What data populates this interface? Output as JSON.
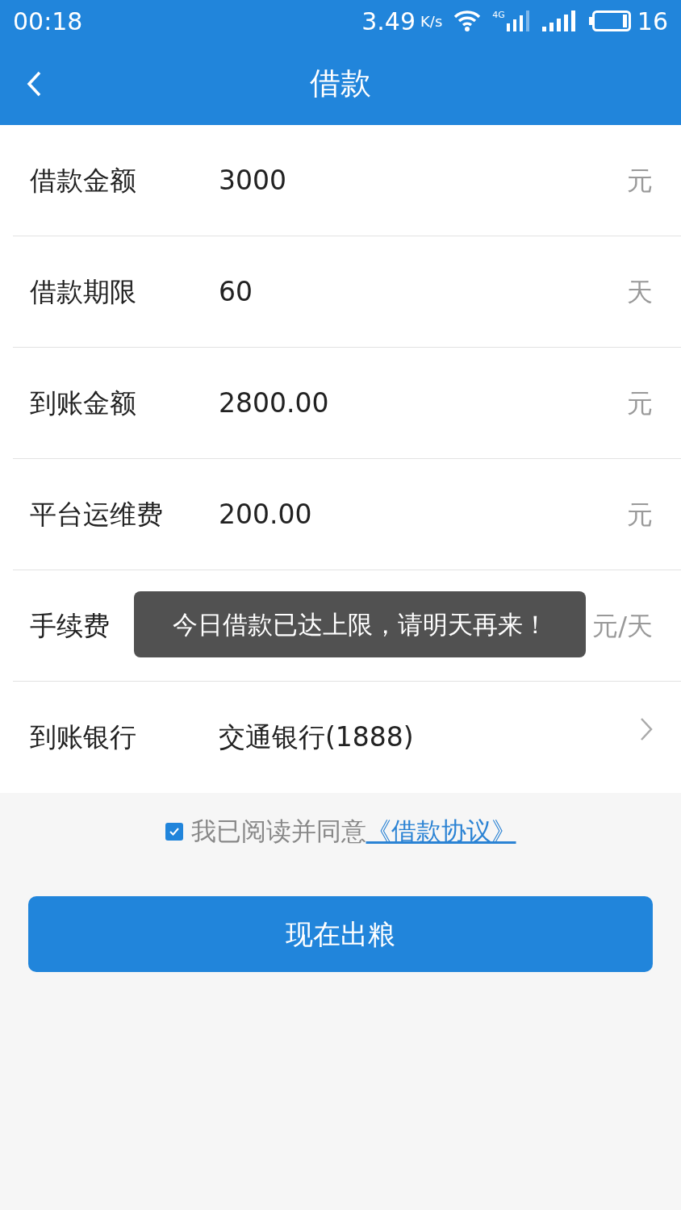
{
  "status_bar": {
    "time": "00:18",
    "speed": "3.49",
    "speed_unit": "K/s",
    "network": "4G",
    "battery": "16"
  },
  "header": {
    "title": "借款"
  },
  "rows": [
    {
      "kind": "unit",
      "label": "借款金额",
      "value": "3000",
      "unit": "元"
    },
    {
      "kind": "unit",
      "label": "借款期限",
      "value": "60",
      "unit": "天"
    },
    {
      "kind": "unit",
      "label": "到账金额",
      "value": "2800.00",
      "unit": "元"
    },
    {
      "kind": "unit",
      "label": "平台运维费",
      "value": "200.00",
      "unit": "元"
    },
    {
      "kind": "unit",
      "label": "手续费",
      "unit": "元/天"
    },
    {
      "kind": "link",
      "label": "到账银行",
      "value": "交通银行(1888)"
    }
  ],
  "agreement": {
    "checked": true,
    "text": "我已阅读并同意",
    "link": "《借款协议》"
  },
  "submit_button": "现在出粮",
  "toast": "今日借款已达上限，请明天再来！"
}
